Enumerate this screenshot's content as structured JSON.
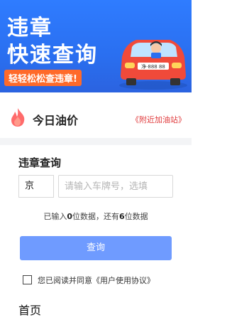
{
  "banner": {
    "title_line1": "违章",
    "title_line2": "快速查询",
    "slogan": "轻轻松松查违章!",
    "plate_text": "净·888 88",
    "colors": {
      "bg": "#2f7cff",
      "slogan_bg": "#ff6a2a",
      "car": "#f04a3a"
    }
  },
  "oil": {
    "icon": "flame-icon",
    "title": "今日油价",
    "nearby_link": "《附近加油站》"
  },
  "query_card": {
    "title": "违章查询",
    "province_value": "京",
    "plate_placeholder": "请输入车牌号，选填",
    "hint_prefix": "已输入",
    "entered_count": "0",
    "hint_middle": "位数据，还有",
    "remaining_count": "6",
    "hint_suffix": "位数据",
    "query_button": "查询",
    "agreement_text": "您已阅读并同意《用户使用协议》"
  },
  "bottom_nav": {
    "home_label": "首页"
  }
}
